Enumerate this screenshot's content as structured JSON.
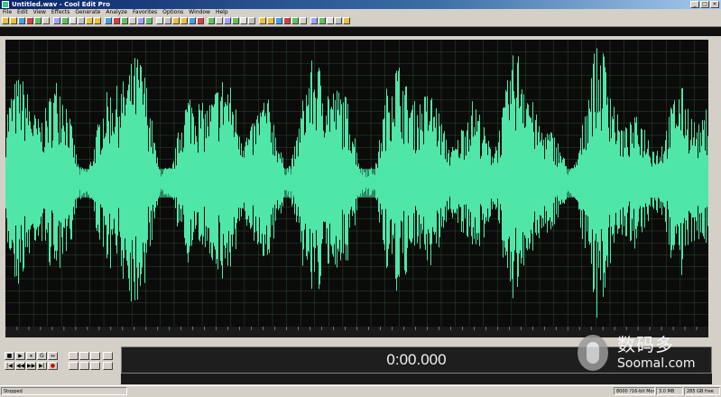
{
  "window": {
    "title": "Untitled.wav - Cool Edit Pro",
    "controls": [
      "_",
      "□",
      "×"
    ]
  },
  "menu": [
    "File",
    "Edit",
    "View",
    "Effects",
    "Generate",
    "Analyze",
    "Favorites",
    "Options",
    "Window",
    "Help"
  ],
  "colors": {
    "waveform": "#4fe6a8",
    "background": "#0b0b0b",
    "grid": "#2a4a2a"
  },
  "transport": {
    "row1": [
      "■",
      "▶",
      "⏸",
      "G",
      "↔"
    ],
    "row2": [
      "|◀",
      "◀◀",
      "▶▶",
      "▶|",
      "●"
    ]
  },
  "time_display": "0:00.000",
  "status": {
    "state": "Stopped",
    "format": "8000 ?16-bit Mono",
    "size": "3.0 MB",
    "free": "285 GB free"
  },
  "watermark": {
    "brand_cn": "数码多",
    "url": "Soomal.com"
  }
}
